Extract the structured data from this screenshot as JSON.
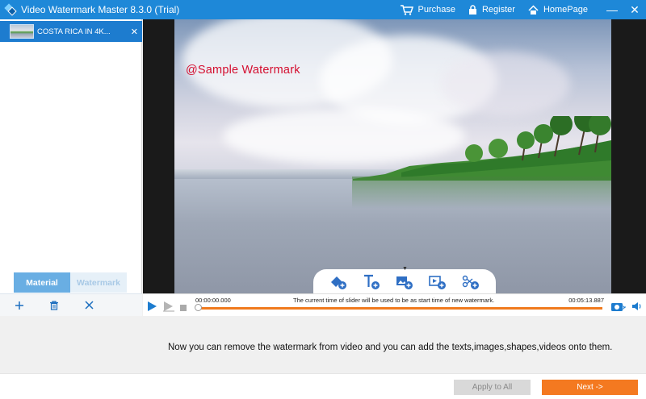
{
  "titlebar": {
    "title": "Video Watermark Master 8.3.0 (Trial)",
    "links": [
      {
        "label": "Purchase",
        "icon": "cart-icon"
      },
      {
        "label": "Register",
        "icon": "lock-icon"
      },
      {
        "label": "HomePage",
        "icon": "home-icon"
      }
    ],
    "window_buttons": [
      "—",
      "✕"
    ]
  },
  "materials": {
    "items": [
      {
        "name": "COSTA RICA IN 4K...",
        "selected": true
      }
    ],
    "tabs": [
      {
        "label": "Material",
        "active": true
      },
      {
        "label": "Watermark",
        "active": false
      }
    ],
    "actions": [
      "add-icon",
      "delete-icon",
      "remove-icon"
    ]
  },
  "preview": {
    "watermark_text": "@Sample  Watermark",
    "toolbar_tools": [
      "add-shape-icon",
      "add-text-icon",
      "add-image-icon",
      "add-video-icon",
      "add-subtitle-icon"
    ]
  },
  "timeline": {
    "start_time": "00:00:00.000",
    "end_time": "00:05:13.887",
    "note": "The current time of slider will be used to be as start time of new watermark.",
    "progress_fraction": 0
  },
  "message": "Now you can remove the watermark from video and you can add the texts,images,shapes,videos onto them.",
  "footer": {
    "apply_label": "Apply to All",
    "next_label": "Next ->"
  },
  "colors": {
    "titlebar": "#1e88d8",
    "accent": "#f47920",
    "watermark": "#d40d2e",
    "tab_active": "#69aee3"
  }
}
